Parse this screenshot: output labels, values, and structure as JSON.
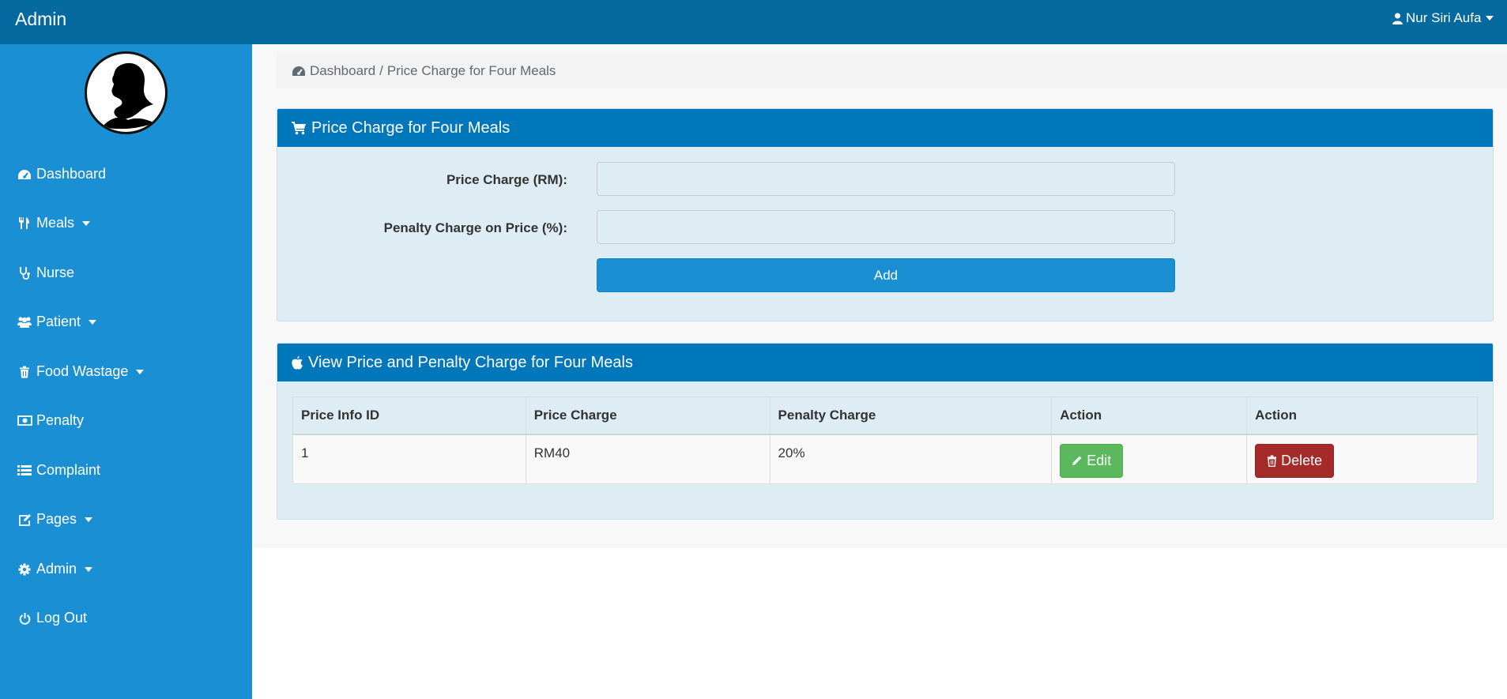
{
  "header": {
    "brand": "Admin",
    "user": "Nur Siri Aufa"
  },
  "sidebar": {
    "items": [
      {
        "label": "Dashboard",
        "icon": "dashboard-icon",
        "dropdown": false
      },
      {
        "label": "Meals",
        "icon": "cutlery-icon",
        "dropdown": true
      },
      {
        "label": "Nurse",
        "icon": "stethoscope-icon",
        "dropdown": false
      },
      {
        "label": "Patient",
        "icon": "users-icon",
        "dropdown": true
      },
      {
        "label": "Food Wastage",
        "icon": "trash-icon",
        "dropdown": true
      },
      {
        "label": "Penalty",
        "icon": "money-icon",
        "dropdown": false
      },
      {
        "label": "Complaint",
        "icon": "list-icon",
        "dropdown": false
      },
      {
        "label": "Pages",
        "icon": "edit-icon",
        "dropdown": true
      },
      {
        "label": "Admin",
        "icon": "gear-icon",
        "dropdown": true
      },
      {
        "label": "Log Out",
        "icon": "power-icon",
        "dropdown": false
      }
    ]
  },
  "breadcrumb": {
    "home": "Dashboard",
    "separator": "/",
    "current": "Price Charge for Four Meals"
  },
  "form_panel": {
    "title": "Price Charge for Four Meals",
    "price_label": "Price Charge (RM):",
    "price_value": "",
    "penalty_label": "Penalty Charge on Price (%):",
    "penalty_value": "",
    "add_label": "Add"
  },
  "view_panel": {
    "title": "View Price and Penalty Charge for Four Meals",
    "columns": [
      "Price Info ID",
      "Price Charge",
      "Penalty Charge",
      "Action",
      "Action"
    ],
    "rows": [
      {
        "id": "1",
        "price": "RM40",
        "penalty": "20%",
        "edit_label": "Edit",
        "delete_label": "Delete"
      }
    ]
  },
  "colors": {
    "topbar": "#03699f",
    "sidebar": "#1a8fd3",
    "panel_header": "#0077bb",
    "panel_body": "#deecf4",
    "edit": "#5cb85c",
    "delete": "#a52a2a"
  }
}
